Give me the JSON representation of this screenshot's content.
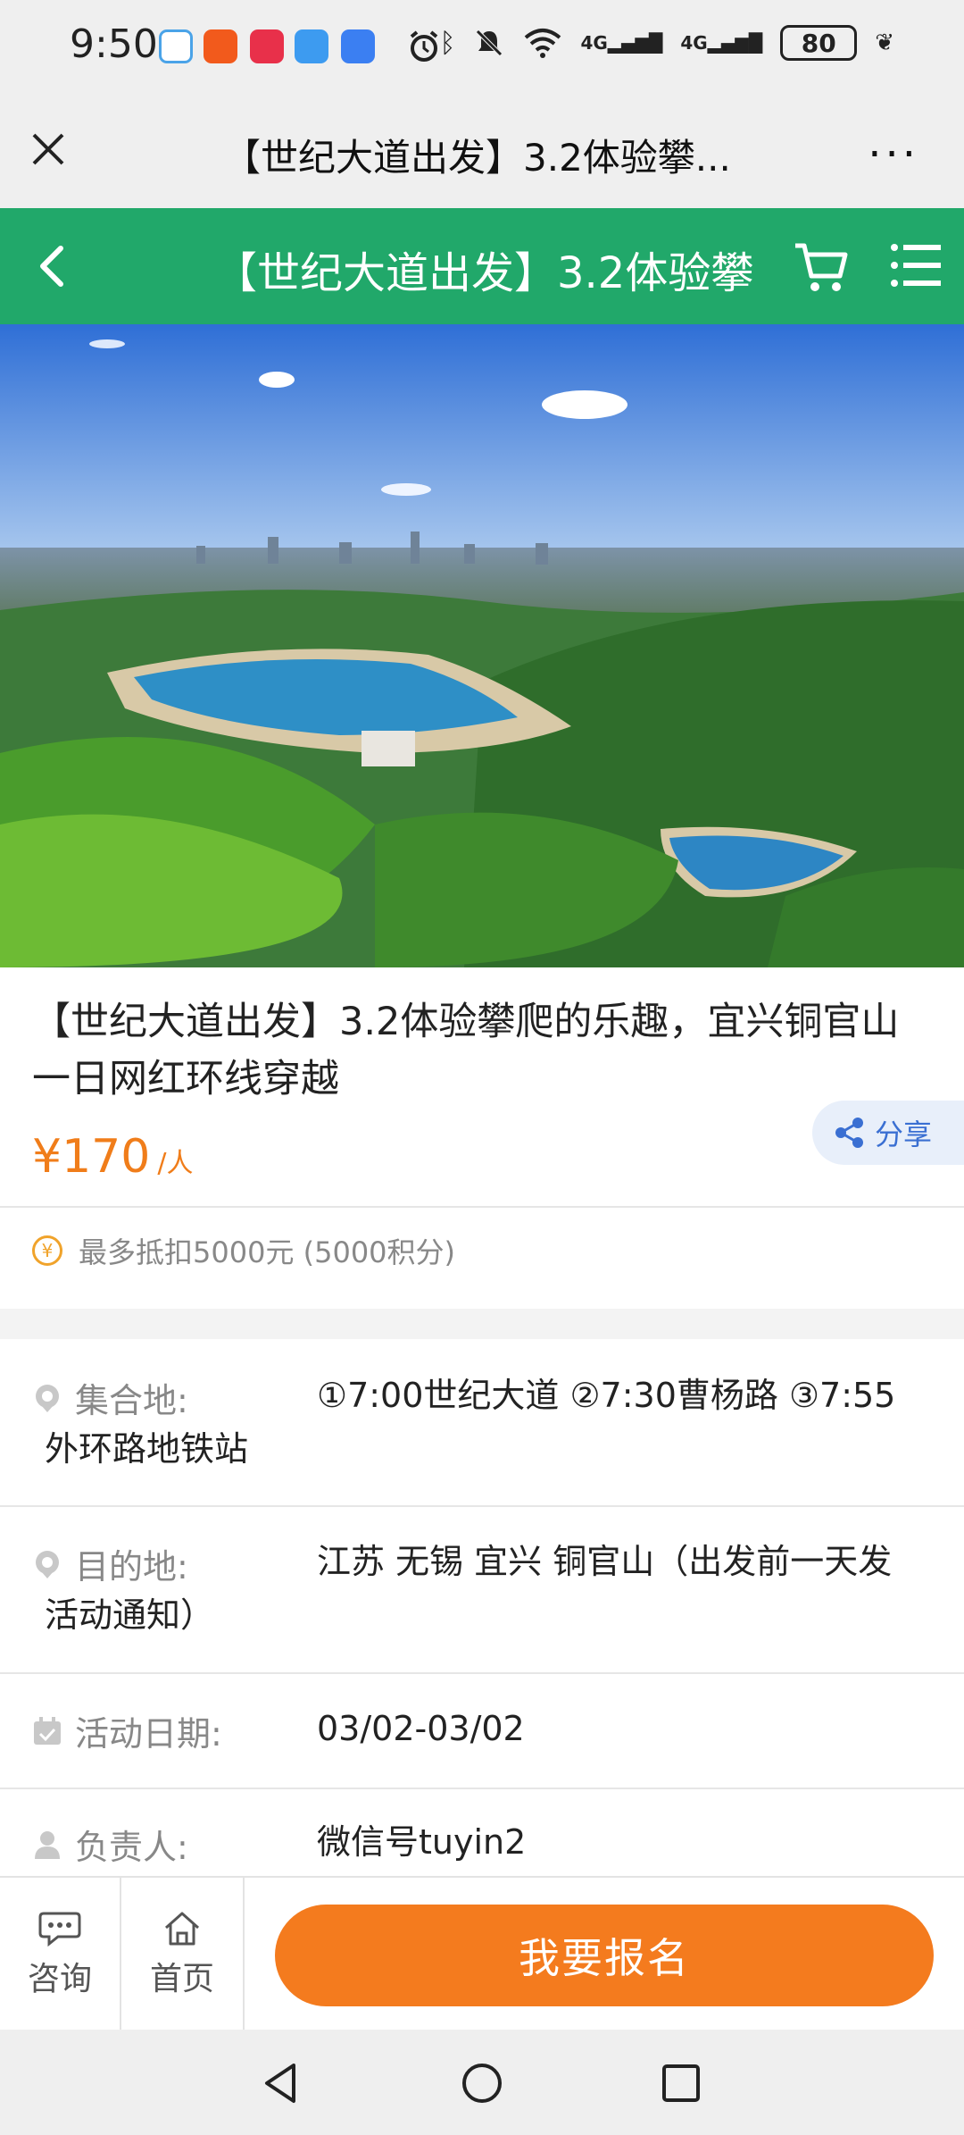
{
  "status_bar": {
    "time": "9:50",
    "battery": "80",
    "signal_labels": [
      "4G",
      "4G"
    ]
  },
  "title_bar": {
    "title": "【世纪大道出发】3.2体验攀...",
    "more_label": "···"
  },
  "header": {
    "title": "【世纪大道出发】3.2体验攀",
    "bg_color": "#21a86a"
  },
  "product": {
    "title": "【世纪大道出发】3.2体验攀爬的乐趣，宜兴铜官山一日网红环线穿越",
    "price": "¥170",
    "price_unit": "/人",
    "share_label": "分享",
    "points_text": "最多抵扣5000元 (5000积分)"
  },
  "details": {
    "meeting": {
      "label": "集合地:",
      "value": "①7:00世纪大道 ②7:30曹杨路 ③7:55",
      "cont": "外环路地铁站"
    },
    "destination": {
      "label": "目的地:",
      "value": "江苏 无锡 宜兴 铜官山（出发前一天发",
      "cont": "活动通知）"
    },
    "date": {
      "label": "活动日期:",
      "value": "03/02-03/02"
    },
    "leader": {
      "label": "负责人:",
      "value": "微信号tuyin2"
    }
  },
  "bottom_bar": {
    "consult_label": "咨询",
    "home_label": "首页",
    "signup_label": "我要报名",
    "accent": "#f47b1e"
  }
}
